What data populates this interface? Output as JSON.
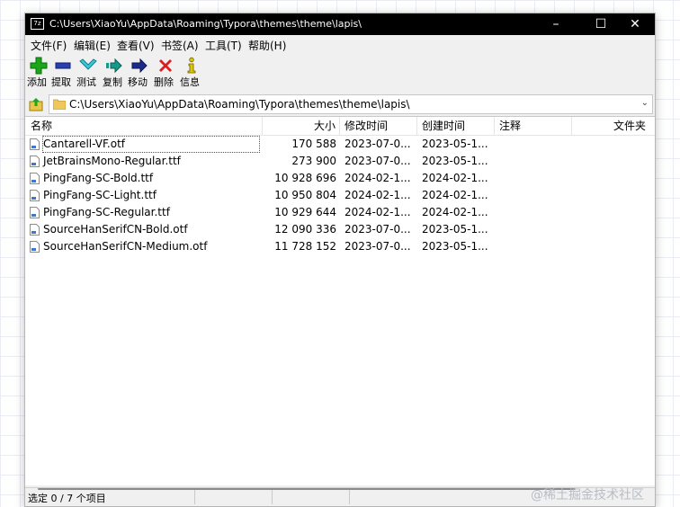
{
  "window": {
    "title": "C:\\Users\\XiaoYu\\AppData\\Roaming\\Typora\\themes\\theme\\lapis\\"
  },
  "titlebar": {
    "minimize": "–",
    "maximize": "☐",
    "close": "✕"
  },
  "menu": [
    "文件(F)",
    "编辑(E)",
    "查看(V)",
    "书签(A)",
    "工具(T)",
    "帮助(H)"
  ],
  "toolbar": [
    {
      "label": "添加",
      "icon": "add-icon",
      "color": "#1aa51a"
    },
    {
      "label": "提取",
      "icon": "extract-icon",
      "color": "#2a3fb0"
    },
    {
      "label": "测试",
      "icon": "test-icon",
      "color": "#1fb5c8"
    },
    {
      "label": "复制",
      "icon": "copy-icon",
      "color": "#17998a"
    },
    {
      "label": "移动",
      "icon": "move-icon",
      "color": "#1b2a8c"
    },
    {
      "label": "删除",
      "icon": "delete-icon",
      "color": "#d81e1e"
    },
    {
      "label": "信息",
      "icon": "info-icon",
      "color": "#e0c800"
    }
  ],
  "address": {
    "path": "C:\\Users\\XiaoYu\\AppData\\Roaming\\Typora\\themes\\theme\\lapis\\"
  },
  "columns": [
    "名称",
    "大小",
    "修改时间",
    "创建时间",
    "注释",
    "文件夹"
  ],
  "files": [
    {
      "name": "Cantarell-VF.otf",
      "size": "170 588",
      "modified": "2023-07-0...",
      "created": "2023-05-1..."
    },
    {
      "name": "JetBrainsMono-Regular.ttf",
      "size": "273 900",
      "modified": "2023-07-0...",
      "created": "2023-05-1..."
    },
    {
      "name": "PingFang-SC-Bold.ttf",
      "size": "10 928 696",
      "modified": "2024-02-1...",
      "created": "2024-02-1..."
    },
    {
      "name": "PingFang-SC-Light.ttf",
      "size": "10 950 804",
      "modified": "2024-02-1...",
      "created": "2024-02-1..."
    },
    {
      "name": "PingFang-SC-Regular.ttf",
      "size": "10 929 644",
      "modified": "2024-02-1...",
      "created": "2024-02-1..."
    },
    {
      "name": "SourceHanSerifCN-Bold.otf",
      "size": "12 090 336",
      "modified": "2023-07-0...",
      "created": "2023-05-1..."
    },
    {
      "name": "SourceHanSerifCN-Medium.otf",
      "size": "11 728 152",
      "modified": "2023-07-0...",
      "created": "2023-05-1..."
    }
  ],
  "status": {
    "text": "选定 0 / 7 个项目"
  },
  "watermark": "@稀土掘金技术社区"
}
